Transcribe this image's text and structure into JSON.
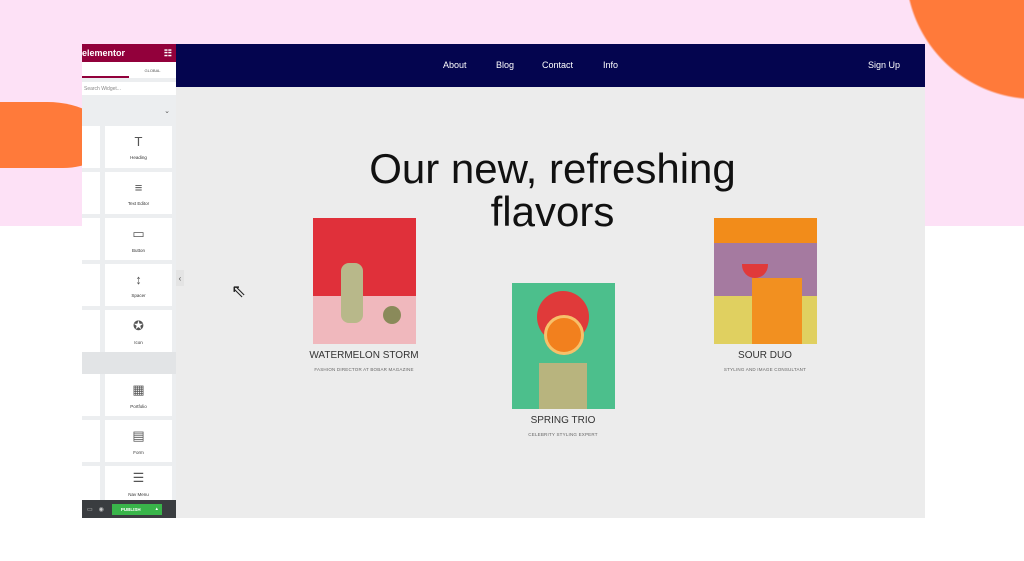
{
  "editor": {
    "brand": "elementor",
    "tabs": [
      "ELEMENTS",
      "GLOBAL"
    ],
    "search_placeholder": "Search Widget...",
    "widgets": [
      {
        "label": "Heading",
        "icon": "heading-icon"
      },
      {
        "label": "Text Editor",
        "icon": "text-editor-icon"
      },
      {
        "label": "Button",
        "icon": "button-icon"
      },
      {
        "label": "Spacer",
        "icon": "spacer-icon"
      },
      {
        "label": "Icon",
        "icon": "star-icon"
      },
      {
        "label": "Portfolio",
        "icon": "portfolio-icon"
      },
      {
        "label": "Form",
        "icon": "form-icon"
      },
      {
        "label": "Nav Menu",
        "icon": "nav-menu-icon"
      }
    ],
    "publish": "PUBLISH"
  },
  "site": {
    "nav": [
      "About",
      "Blog",
      "Contact",
      "Info"
    ],
    "signup": "Sign Up",
    "heading_line1": "Our new, refreshing",
    "heading_line2": "flavors",
    "cards": [
      {
        "title": "WATERMELON STORM",
        "subtitle": "FASHION DIRECTOR AT BOBAR MAGAZINE"
      },
      {
        "title": "SPRING TRIO",
        "subtitle": "CELEBRITY STYLING EXPERT"
      },
      {
        "title": "SOUR DUO",
        "subtitle": "STYLING AND IMAGE CONSULTANT"
      }
    ]
  },
  "colors": {
    "brand": "#92003b",
    "nav": "#04054f",
    "publish": "#39b54a",
    "accent": "#ff7a3a"
  }
}
